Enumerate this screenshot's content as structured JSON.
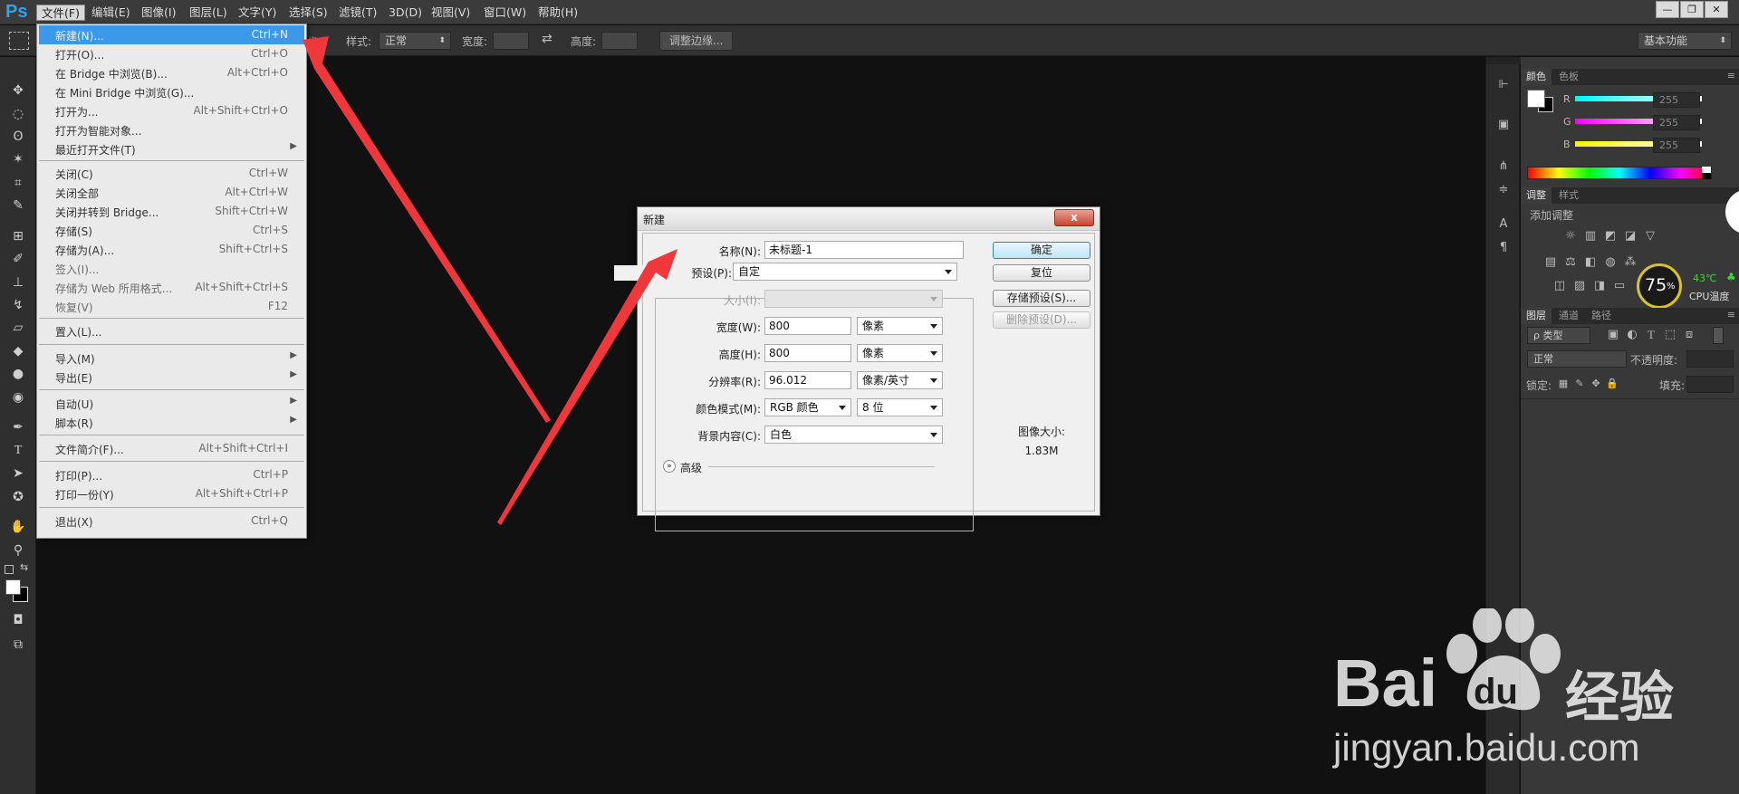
{
  "menubar": {
    "logo": "Ps",
    "items": [
      "文件(F)",
      "编辑(E)",
      "图像(I)",
      "图层(L)",
      "文字(Y)",
      "选择(S)",
      "滤镜(T)",
      "3D(D)",
      "视图(V)",
      "窗口(W)",
      "帮助(H)"
    ],
    "window_buttons": [
      "—",
      "❐",
      "✕"
    ]
  },
  "options": {
    "style_label": "样式:",
    "style_value": "正常",
    "width_label": "宽度:",
    "height_label": "高度:",
    "refine_button": "调整边缘...",
    "workspace": "基本功能"
  },
  "file_menu": {
    "items": [
      {
        "label": "新建(N)...",
        "shortcut": "Ctrl+N"
      },
      {
        "label": "打开(O)...",
        "shortcut": "Ctrl+O"
      },
      {
        "label": "在 Bridge 中浏览(B)...",
        "shortcut": "Alt+Ctrl+O"
      },
      {
        "label": "在 Mini Bridge 中浏览(G)...",
        "shortcut": ""
      },
      {
        "label": "打开为...",
        "shortcut": "Alt+Shift+Ctrl+O"
      },
      {
        "label": "打开为智能对象...",
        "shortcut": ""
      },
      {
        "label": "最近打开文件(T)",
        "shortcut": ""
      },
      {
        "label": "关闭(C)",
        "shortcut": "Ctrl+W"
      },
      {
        "label": "关闭全部",
        "shortcut": "Alt+Ctrl+W"
      },
      {
        "label": "关闭并转到 Bridge...",
        "shortcut": "Shift+Ctrl+W"
      },
      {
        "label": "存储(S)",
        "shortcut": "Ctrl+S"
      },
      {
        "label": "存储为(A)...",
        "shortcut": "Shift+Ctrl+S"
      },
      {
        "label": "签入(I)...",
        "shortcut": ""
      },
      {
        "label": "存储为 Web 所用格式...",
        "shortcut": "Alt+Shift+Ctrl+S"
      },
      {
        "label": "恢复(V)",
        "shortcut": "F12"
      },
      {
        "label": "置入(L)...",
        "shortcut": ""
      },
      {
        "label": "导入(M)",
        "shortcut": ""
      },
      {
        "label": "导出(E)",
        "shortcut": ""
      },
      {
        "label": "自动(U)",
        "shortcut": ""
      },
      {
        "label": "脚本(R)",
        "shortcut": ""
      },
      {
        "label": "文件简介(F)...",
        "shortcut": "Alt+Shift+Ctrl+I"
      },
      {
        "label": "打印(P)...",
        "shortcut": "Ctrl+P"
      },
      {
        "label": "打印一份(Y)",
        "shortcut": "Alt+Shift+Ctrl+P"
      },
      {
        "label": "退出(X)",
        "shortcut": "Ctrl+Q"
      }
    ]
  },
  "dialog": {
    "title": "新建",
    "close": "x",
    "name_label": "名称(N):",
    "name_value": "未标题-1",
    "preset_label": "预设(P):",
    "preset_value": "自定",
    "size_label": "大小(I):",
    "width_label": "宽度(W):",
    "width_value": "800",
    "width_unit": "像素",
    "height_label": "高度(H):",
    "height_value": "800",
    "height_unit": "像素",
    "resolution_label": "分辨率(R):",
    "resolution_value": "96.012",
    "resolution_unit": "像素/英寸",
    "colormode_label": "颜色模式(M):",
    "colormode_value": "RGB 颜色",
    "bitdepth_value": "8 位",
    "background_label": "背景内容(C):",
    "background_value": "白色",
    "advanced_label": "高级",
    "ok_button": "确定",
    "reset_button": "复位",
    "save_preset_button": "存储预设(S)...",
    "delete_preset_button": "删除预设(D)...",
    "image_size_label": "图像大小:",
    "image_size_value": "1.83M"
  },
  "color_panel": {
    "tabs": [
      "颜色",
      "色板"
    ],
    "channels": [
      {
        "name": "R",
        "value": "255"
      },
      {
        "name": "G",
        "value": "255"
      },
      {
        "name": "B",
        "value": "255"
      }
    ]
  },
  "adjust_panel": {
    "tabs": [
      "调整",
      "样式"
    ],
    "add_label": "添加调整"
  },
  "cpu_widget": {
    "percent": "75",
    "percent_sign": "%",
    "temp": "43℃",
    "label": "CPU温度"
  },
  "layers_panel": {
    "tabs": [
      "图层",
      "通道",
      "路径"
    ],
    "filter_label": "ρ 类型",
    "blend_mode": "正常",
    "opacity_label": "不透明度:",
    "lock_label": "锁定:",
    "fill_label": "填充:"
  },
  "watermark": {
    "brand": "Bai",
    "brand_du": "du",
    "suffix": "经验",
    "url": "jingyan.baidu.com"
  },
  "colors": {
    "accent": "#3c98e8",
    "arrow": "#f0373c"
  }
}
